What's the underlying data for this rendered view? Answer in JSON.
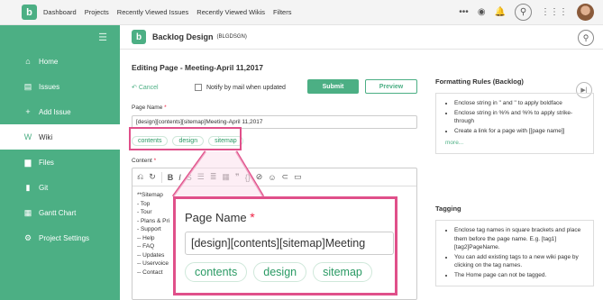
{
  "topbar": {
    "logo": "b",
    "nav": [
      "Dashboard",
      "Projects",
      "Recently Viewed Issues",
      "Recently Viewed Wikis",
      "Filters"
    ],
    "icons": [
      "more-icon",
      "watch-icon",
      "bell-icon",
      "search-icon",
      "apps-icon",
      "avatar"
    ]
  },
  "sidebar": {
    "collapse_icon": "menu-icon",
    "items": [
      {
        "label": "Home",
        "icon": "home-icon"
      },
      {
        "label": "Issues",
        "icon": "issues-icon"
      },
      {
        "label": "Add Issue",
        "icon": "plus-icon"
      },
      {
        "label": "Wiki",
        "icon": "wiki-icon"
      },
      {
        "label": "Files",
        "icon": "files-icon"
      },
      {
        "label": "Git",
        "icon": "git-icon"
      },
      {
        "label": "Gantt Chart",
        "icon": "gantt-icon"
      },
      {
        "label": "Project Settings",
        "icon": "gear-icon"
      }
    ]
  },
  "project": {
    "logo": "b",
    "name": "Backlog Design",
    "key": "(BLGDSGN)"
  },
  "editor": {
    "title": "Editing Page - Meeting-April 11,2017",
    "cancel": "Cancel",
    "notify": "Notify by mail when updated",
    "submit": "Submit",
    "preview": "Preview",
    "page_name_label": "Page Name",
    "page_name_value": "[design][contents][sitemap]Meeting-April 11,2017",
    "zoom_page_name_value": "[design][contents][sitemap]Meeting",
    "tags": [
      "contents",
      "design",
      "sitemap"
    ],
    "content_label": "Content",
    "content_lines": [
      "**Sitemap",
      "- Top",
      "- Tour",
      "- Plans & Pri",
      "- Support",
      "-- Help",
      "-- FAQ",
      "-- Updates",
      "-- Uservoice",
      "-- Contact"
    ]
  },
  "formatting": {
    "title": "Formatting Rules (Backlog)",
    "rules": [
      "Enclose string in '' and '' to apply boldface",
      "Enclose string in %% and %% to apply strike-through",
      "Create a link for a page with [[page name]]"
    ],
    "more": "more..."
  },
  "tagging": {
    "title": "Tagging",
    "rules": [
      "Enclose tag names in square brackets and place them before the page name. E.g. [tag1][tag2]PageName.",
      "You can add existing tags to a new wiki page by clicking on the tag names.",
      "The Home page can not be tagged."
    ]
  },
  "colors": {
    "brand_green": "#4caf84",
    "highlight_pink": "#e0508a",
    "required_red": "#ee2244"
  }
}
